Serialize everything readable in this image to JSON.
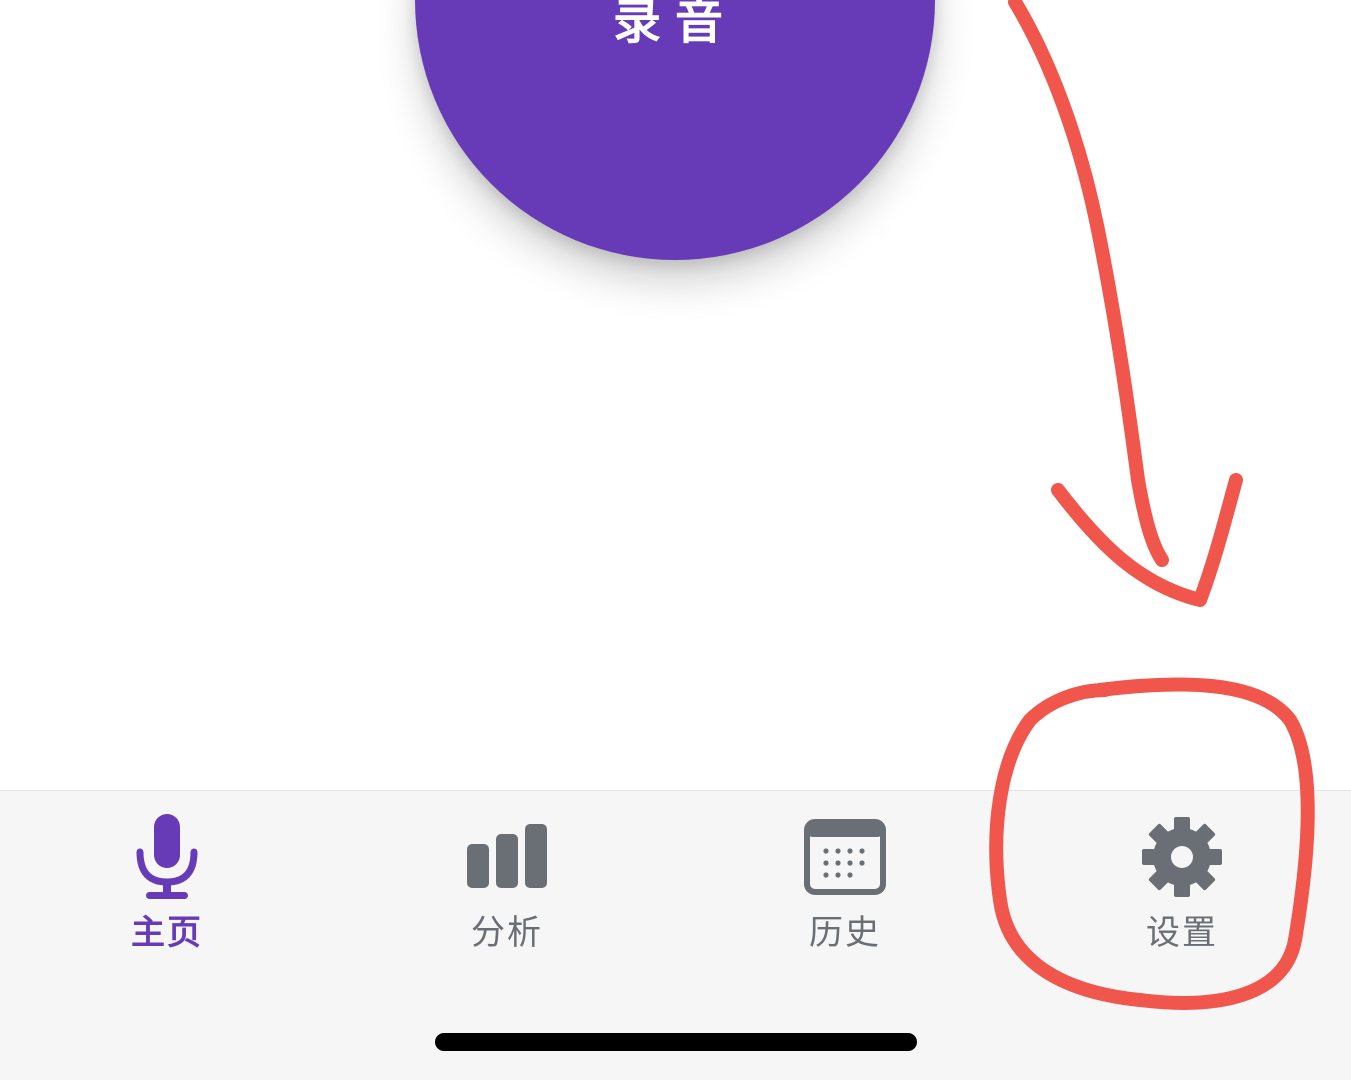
{
  "record": {
    "label": "录音"
  },
  "tabs": [
    {
      "id": "home",
      "label": "主页",
      "icon": "microphone-icon",
      "active": true
    },
    {
      "id": "analysis",
      "label": "分析",
      "icon": "bar-chart-icon",
      "active": false
    },
    {
      "id": "history",
      "label": "历史",
      "icon": "calendar-icon",
      "active": false
    },
    {
      "id": "settings",
      "label": "设置",
      "icon": "gear-icon",
      "active": false
    }
  ],
  "colors": {
    "accent": "#673bb7",
    "inactive": "#6a6f75",
    "tab_bar_bg": "#f6f6f6",
    "annotation": "#f0564c"
  }
}
